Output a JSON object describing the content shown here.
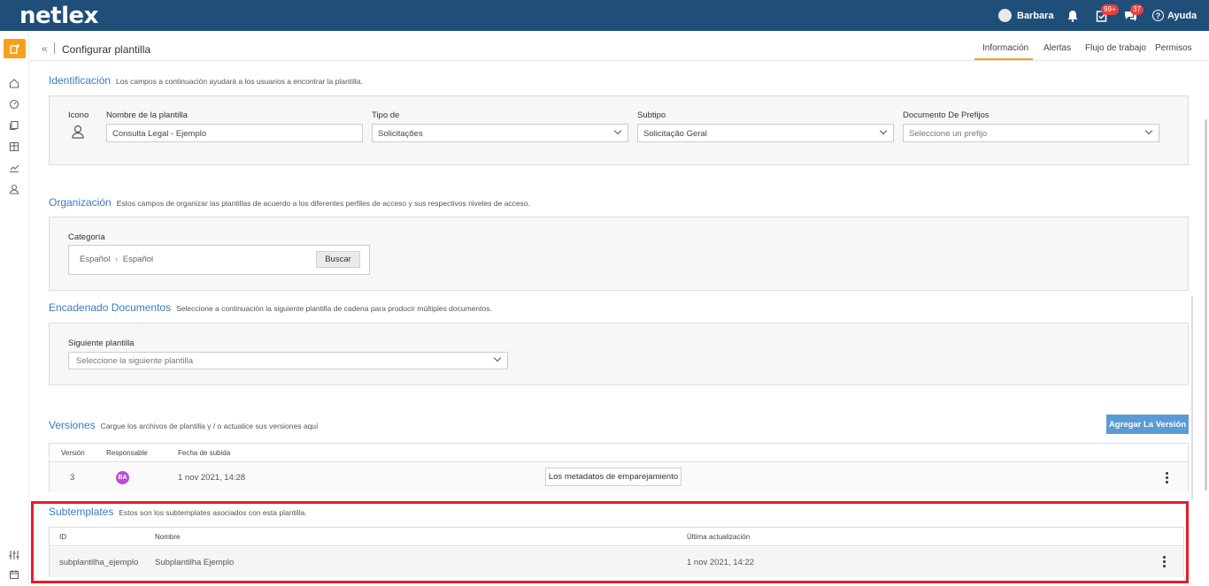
{
  "brand": {
    "logo": "netlex",
    "bar_color": "#1f4e79",
    "accent": "#f6a01a",
    "link": "#3a7bbf"
  },
  "topbar": {
    "user_name": "Barbara",
    "tasks_badge": "99+",
    "chat_badge": "37",
    "help_label": "Ayuda"
  },
  "header": {
    "title": "Configurar plantilla",
    "collapse_icon": "«",
    "tabs": [
      {
        "label": "Información",
        "active": true
      },
      {
        "label": "Alertas"
      },
      {
        "label": "Flujo de trabajo"
      },
      {
        "label": "Permisos"
      }
    ]
  },
  "identificacion": {
    "title": "Identificación",
    "desc": "Los campos a continuación ayudará a los usuarios a encontrar la plantilla.",
    "icon_label": "Icono",
    "name_label": "Nombre de la plantilla",
    "name_value": "Consulta Legal - Ejemplo",
    "type_label": "Tipo de",
    "type_value": "Solicitações",
    "subtype_label": "Subtipo",
    "subtype_value": "Solicitação Geral",
    "prefix_label": "Documento De Prefijos",
    "prefix_placeholder": "Seleccione un prefijo"
  },
  "organizacion": {
    "title": "Organización",
    "desc": "Estos campos de organizar las plantillas de acuerdo a los diferentes perfiles de acceso y sus respectivos niveles de acceso.",
    "category_label": "Categoría",
    "crumb_a": "Español",
    "crumb_b": "Español",
    "search_button": "Buscar"
  },
  "encadenado": {
    "title": "Encadenado Documentos",
    "desc": "Seleccione a continuación la siguiente plantilla de cadena para producir múltiples documentos.",
    "next_label": "Siguiente plantilla",
    "next_placeholder": "Seleccione la siguiente plantilla"
  },
  "versiones": {
    "title": "Versiones",
    "desc": "Cargue los archivos de plantilla y / o actualice sus versiones aquí",
    "add_button": "Agregar La Versión",
    "columns": [
      "Versión",
      "Responsable",
      "Fecha de subida"
    ],
    "row": {
      "version": "3",
      "avatar": "BA",
      "date": "1 nov 2021, 14:28",
      "metadata_button": "Los metadatos de emparejamiento"
    }
  },
  "subtemplates": {
    "title": "Subtemplates",
    "desc": "Estos son los subtemplates asociados con esta plantilla.",
    "columns": [
      "ID",
      "Nombre",
      "Última actualización"
    ],
    "row": {
      "id": "subplantilha_ejemplo",
      "name": "Subplantilha Ejemplo",
      "updated": "1 nov 2021, 14:22"
    }
  }
}
